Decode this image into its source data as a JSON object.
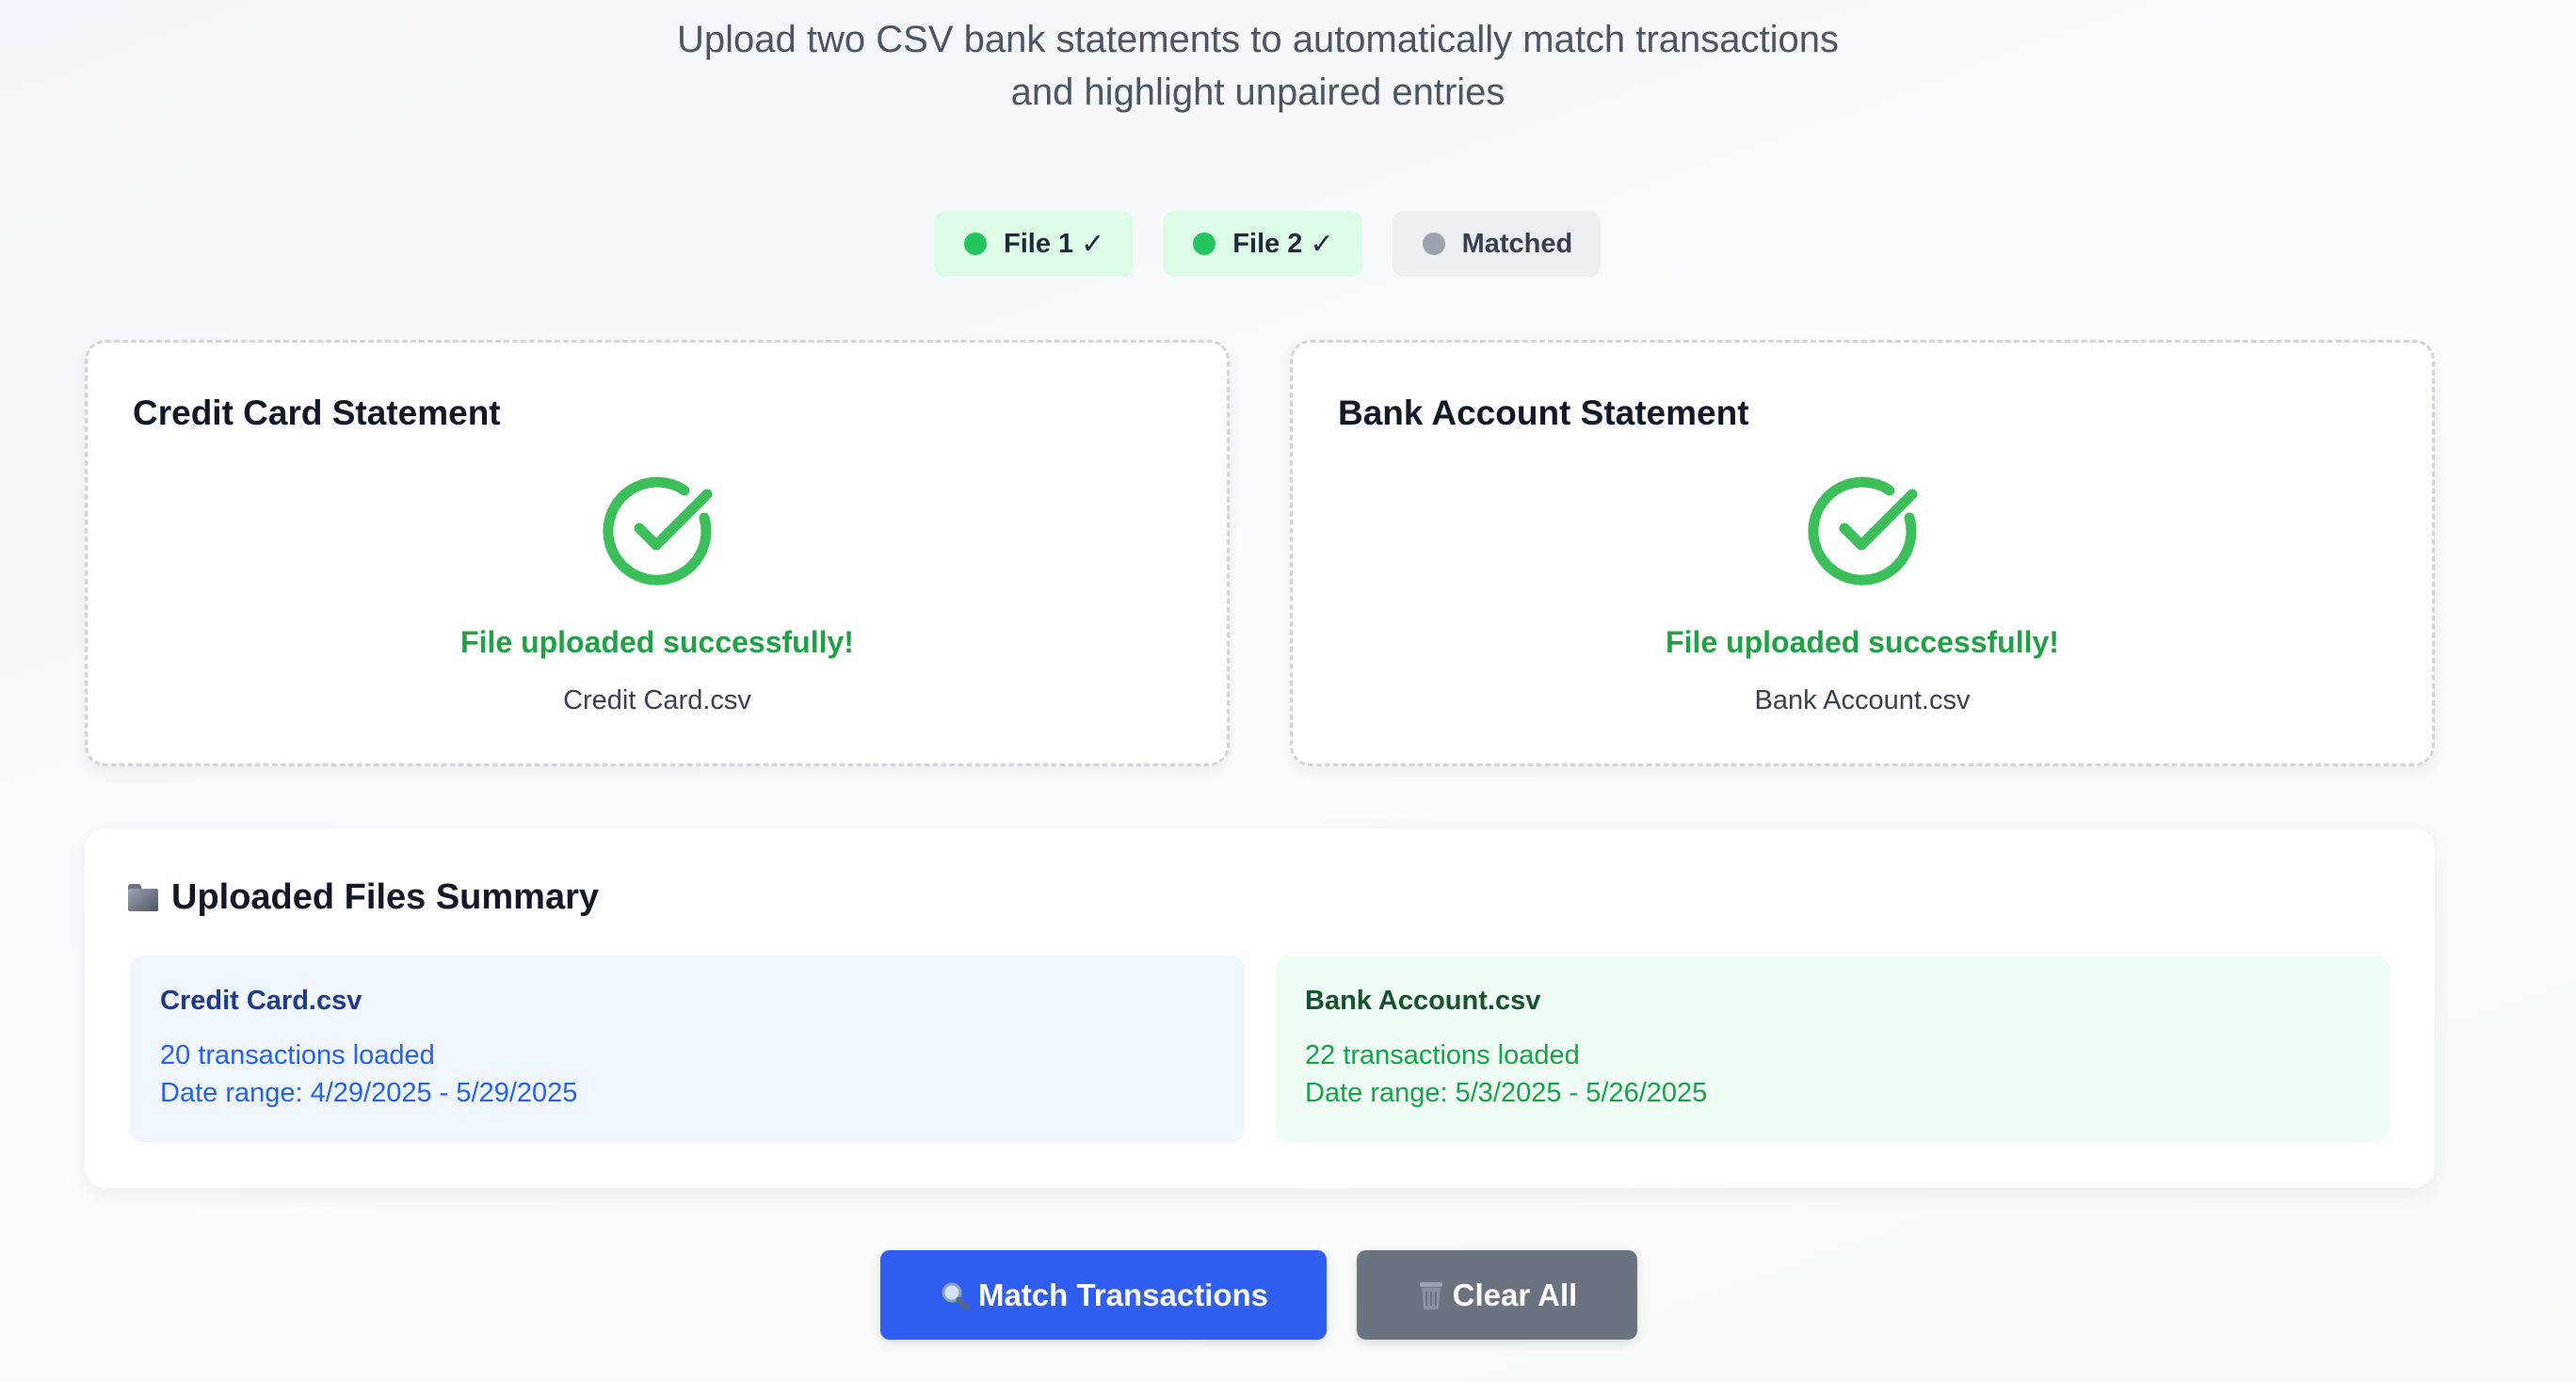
{
  "header": {
    "subtitle_line1": "Upload two CSV bank statements to automatically match transactions",
    "subtitle_line2": "and highlight unpaired entries"
  },
  "status": [
    {
      "label": "File 1",
      "check": "✓",
      "state": "done",
      "dot_color": "#22c55e"
    },
    {
      "label": "File 2",
      "check": "✓",
      "state": "done",
      "dot_color": "#22c55e"
    },
    {
      "label": "Matched",
      "check": "",
      "state": "pending",
      "dot_color": "#9ca3af"
    }
  ],
  "uploads": [
    {
      "title": "Credit Card Statement",
      "message": "File uploaded successfully!",
      "file_name": "Credit Card.csv",
      "icon": "check-circle-icon"
    },
    {
      "title": "Bank Account Statement",
      "message": "File uploaded successfully!",
      "file_name": "Bank Account.csv",
      "icon": "check-circle-icon"
    }
  ],
  "summary": {
    "title": "Uploaded Files Summary",
    "icon": "folder-icon",
    "files": [
      {
        "name": "Credit Card.csv",
        "count_text": "20 transactions loaded",
        "range_text": "Date range: 4/29/2025 - 5/29/2025"
      },
      {
        "name": "Bank Account.csv",
        "count_text": "22 transactions loaded",
        "range_text": "Date range: 5/3/2025 - 5/26/2025"
      }
    ]
  },
  "actions": {
    "match_label": "Match Transactions",
    "match_icon": "magnifier-icon",
    "clear_label": "Clear All",
    "clear_icon": "trash-icon"
  },
  "colors": {
    "success": "#22a046",
    "primary": "#2f5ef0",
    "secondary": "#6b7280"
  }
}
